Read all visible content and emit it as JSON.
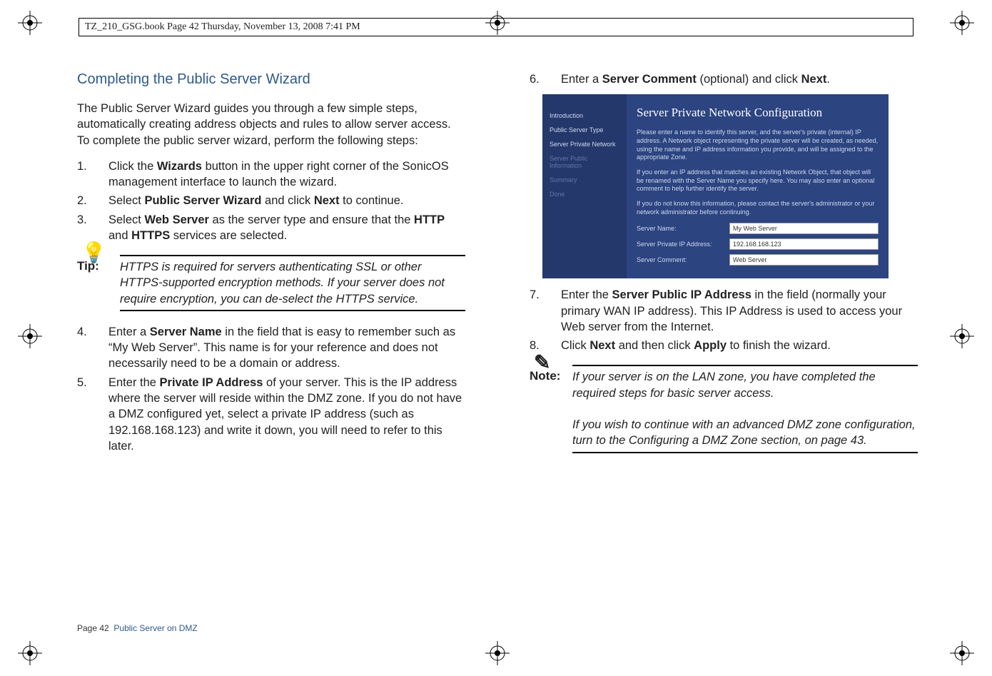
{
  "header": "TZ_210_GSG.book  Page 42  Thursday, November 13, 2008  7:41 PM",
  "left": {
    "heading": "Completing the Public Server Wizard",
    "intro": "The Public Server Wizard guides you through a few simple steps, automatically creating address objects and rules to allow server access. To complete the public server wizard, perform the following steps:",
    "steps_a": [
      {
        "n": "1.",
        "pre": "Click the ",
        "b1": "Wizards",
        "post": " button in the upper right corner of the SonicOS management interface to launch the wizard."
      },
      {
        "n": "2.",
        "pre": "Select ",
        "b1": "Public Server Wizard",
        "mid": " and click ",
        "b2": "Next",
        "post": " to continue."
      },
      {
        "n": "3.",
        "pre": "Select ",
        "b1": "Web Server",
        "mid": " as the server type and ensure that the ",
        "b2": "HTTP",
        "mid2": " and ",
        "b3": "HTTPS",
        "post": " services are selected."
      }
    ],
    "tip": {
      "label": "Tip:",
      "text": "HTTPS is required for servers authenticating SSL or other HTTPS-supported encryption methods. If your server does not require encryption, you can de-select the HTTPS service."
    },
    "steps_b": [
      {
        "n": "4.",
        "pre": "Enter a ",
        "b1": "Server Name",
        "post": " in the field that is easy to remember such as “My Web Server”. This name is for your reference and does not necessarily need to be a domain or address."
      },
      {
        "n": "5.",
        "pre": "Enter the ",
        "b1": "Private IP Address",
        "post": " of your server. This is the IP address where the server will reside within the DMZ zone. If you do not have a DMZ configured yet, select a private IP address (such as 192.168.168.123) and write it down, you will need to refer to this later."
      }
    ]
  },
  "right": {
    "step6": {
      "n": "6.",
      "pre": "Enter a ",
      "b1": "Server Comment",
      "mid": " (optional) and click ",
      "b2": "Next",
      "post": "."
    },
    "wizard": {
      "title": "Server Private Network Configuration",
      "nav": [
        "Introduction",
        "Public Server Type",
        "Server Private Network",
        "Server Public Information",
        "Summary",
        "Done"
      ],
      "para1": "Please enter a name to identify this server, and the server's private (internal) IP address. A Network object representing the private server will be created, as needed, using the name and IP address information you provide, and will be assigned to the appropriate Zone.",
      "para2": "If you enter an IP address that matches an existing Network Object, that object will be renamed with the Server Name you specify here. You may also enter an optional comment to help further identify the server.",
      "para3": "If you do not know this information, please contact the server's administrator or your network administrator before continuing.",
      "fields": [
        {
          "label": "Server Name:",
          "value": "My Web Server"
        },
        {
          "label": "Server Private IP Address:",
          "value": "192.168.168.123"
        },
        {
          "label": "Server Comment:",
          "value": "Web Server"
        }
      ]
    },
    "step7": {
      "n": "7.",
      "pre": "Enter the ",
      "b1": "Server Public IP Address",
      "post": " in the field (normally your primary WAN IP address). This IP Address is used to access your Web server from the Internet."
    },
    "step8": {
      "n": "8.",
      "pre": "Click ",
      "b1": "Next",
      "mid": " and then click ",
      "b2": "Apply",
      "post": " to finish the wizard."
    },
    "note": {
      "label": "Note:",
      "text1": "If your server is on the LAN zone, you have completed the required steps for basic server access.",
      "text2": "If you wish to continue with an advanced DMZ zone configuration, turn to the Configuring a DMZ Zone section, on page 43."
    }
  },
  "footer": {
    "page": "Page 42",
    "section": "Public Server on DMZ"
  }
}
